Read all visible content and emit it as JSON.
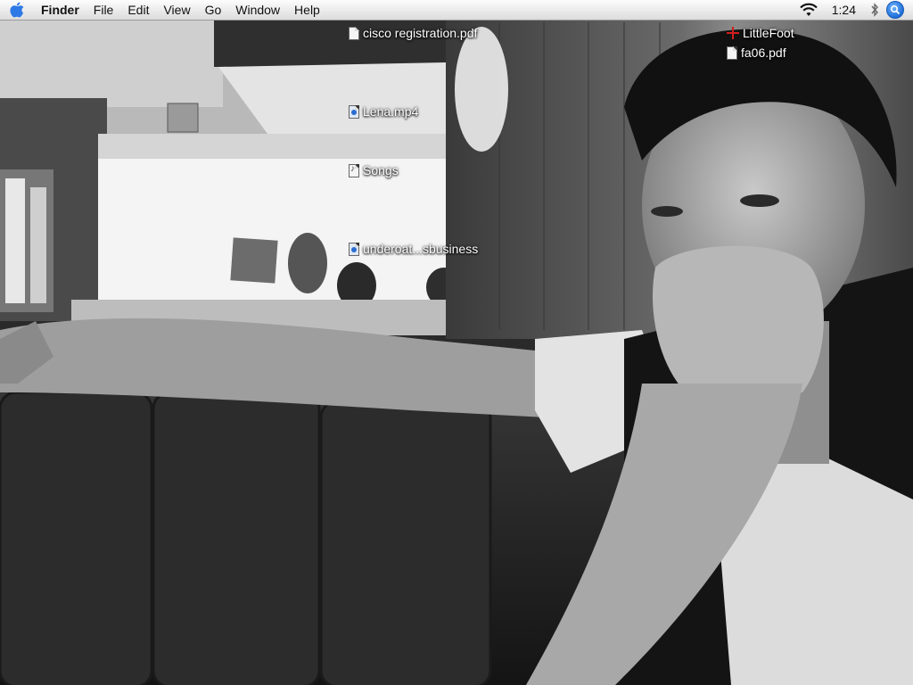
{
  "menubar": {
    "app_name": "Finder",
    "menus": [
      "File",
      "Edit",
      "View",
      "Go",
      "Window",
      "Help"
    ],
    "clock": "1:24",
    "icons": {
      "apple": "apple-icon",
      "wifi": "wifi-icon",
      "bluetooth": "bluetooth-icon",
      "spotlight": "spotlight-icon"
    }
  },
  "desktop": {
    "items": [
      {
        "label": "cisco registration.pdf",
        "icon": "pdf-document-icon"
      },
      {
        "label": "Lena.mp4",
        "icon": "video-file-icon"
      },
      {
        "label": "Songs",
        "icon": "music-file-icon"
      },
      {
        "label": "underoat...sbusiness",
        "icon": "video-file-icon"
      },
      {
        "label": "LittleFoot",
        "icon": "application-icon"
      },
      {
        "label": "fa06.pdf",
        "icon": "pdf-document-icon"
      }
    ]
  },
  "colors": {
    "menubar_top": "#fdfdfd",
    "menubar_bottom": "#dcdcdc",
    "spotlight_blue": "#1f6fd8",
    "apple_blue": "#2e79e6",
    "littlefoot_red": "#d11e1e"
  }
}
